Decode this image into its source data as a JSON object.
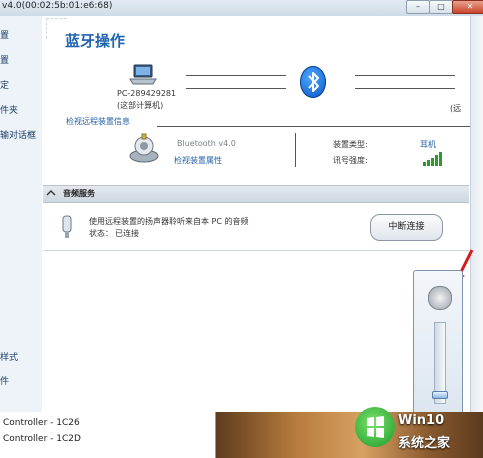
{
  "window": {
    "title": "v4.0(00:02:5b:01:e6:68)",
    "minimize": "–",
    "maximize": "□",
    "close": "✕"
  },
  "sidebar": {
    "items": [
      "置",
      "置",
      "定",
      "件夹",
      "输对话框",
      "样式",
      "件"
    ]
  },
  "main": {
    "heading": "蓝牙操作",
    "pc_name": "PC-289429281",
    "pc_sub": "(这部计算机)",
    "remote_sub": "(远",
    "check_remote_link": "检视远程装置信息",
    "bt_version": "Bluetooth v4.0",
    "check_props_link": "检视装置属性",
    "device_type_label": "装置类型:",
    "device_type_value": "耳机",
    "signal_label": "讯号强度:"
  },
  "audio": {
    "section_title": "音频服务",
    "description": "使用远程装置的扬声器聆听来自本 PC 的音频",
    "status_label": "状态：",
    "status_value": "已连接",
    "disconnect_button": "中断连接"
  },
  "background_list": {
    "rows": [
      "Controller - 1C26",
      "Controller - 1C2D"
    ]
  },
  "watermark": {
    "line1": "Win10",
    "line2": "系统之家"
  },
  "colors": {
    "heading": "#1f64b0",
    "link": "#2461a8",
    "bluetooth": "#0c57c5",
    "signal": "#2e9a2e"
  }
}
